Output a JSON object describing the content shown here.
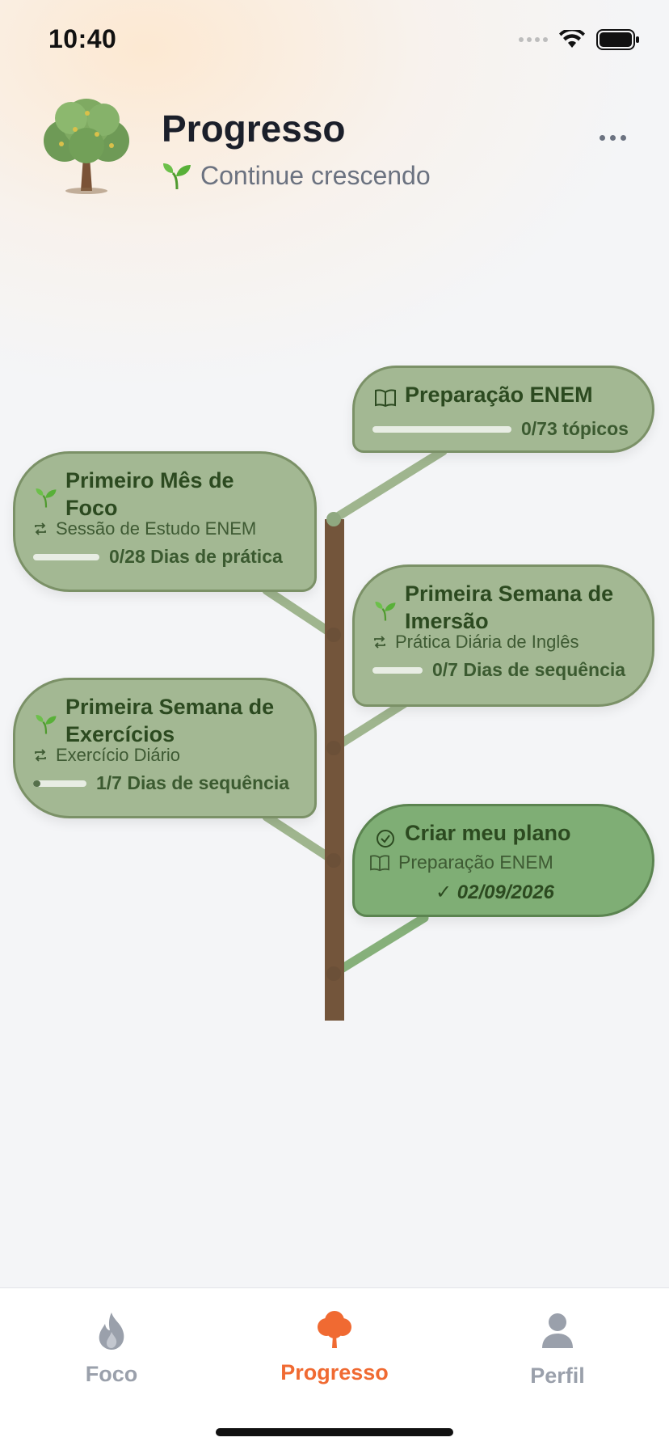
{
  "status": {
    "time": "10:40"
  },
  "header": {
    "title": "Progresso",
    "subtitle": "Continue crescendo"
  },
  "milestones": [
    {
      "id": "preparacao-enem",
      "title": "Preparação ENEM",
      "progress_text": "0/73 tópicos",
      "progress": 0.0,
      "icon": "book-icon"
    },
    {
      "id": "primeiro-mes-de-foco",
      "title": "Primeiro Mês de Foco",
      "habit": "Sessão de Estudo ENEM",
      "progress_text": "0/28 Dias de prática",
      "progress": 0.0,
      "icon": "sprout-icon"
    },
    {
      "id": "primeira-semana-de-imersao",
      "title": "Primeira Semana de Imersão",
      "habit": "Prática Diária de Inglês",
      "progress_text": "0/7 Dias de sequência",
      "progress": 0.0,
      "icon": "sprout-icon"
    },
    {
      "id": "primeira-semana-de-exercicios",
      "title": "Primeira Semana de Exercícios",
      "habit": "Exercício Diário",
      "progress_text": "1/7 Dias de sequência",
      "progress": 0.14,
      "icon": "sprout-icon"
    },
    {
      "id": "criar-meu-plano",
      "title": "Criar meu plano",
      "goal": "Preparação ENEM",
      "completed_text": "✓ 02/09/2026",
      "progress": 1.0,
      "icon": "check-circle-icon",
      "status": "completed"
    }
  ],
  "tabs": [
    {
      "label": "Foco",
      "icon": "flame-icon",
      "active": false
    },
    {
      "label": "Progresso",
      "icon": "tree-icon",
      "active": true
    },
    {
      "label": "Perfil",
      "icon": "person-icon",
      "active": false
    }
  ],
  "colors": {
    "accent": "#f06a32",
    "bubble": "#a3b893",
    "bubble_done": "#7fae75",
    "trunk": "#73553b",
    "branch": "#9fb58e"
  }
}
